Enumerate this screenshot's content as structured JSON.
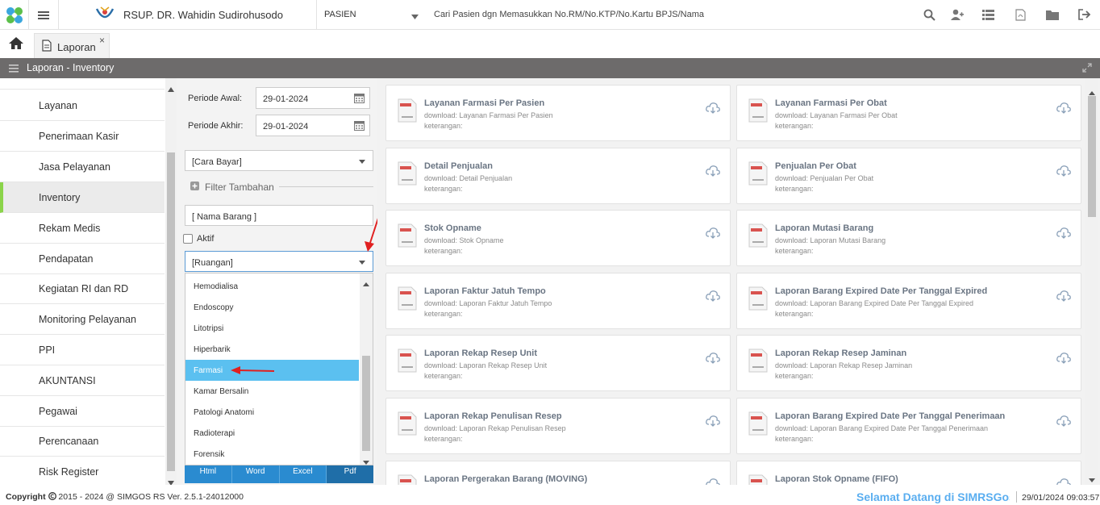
{
  "header": {
    "hospital_name": "RSUP. DR. Wahidin Sudirohusodo",
    "patient_select": "PASIEN",
    "search_placeholder": "Cari Pasien dgn Memasukkan No.RM/No.KTP/No.Kartu BPJS/Nama",
    "icons": [
      "search-icon",
      "add-user-icon",
      "list-icon",
      "pdf-icon",
      "folder-icon",
      "logout-icon"
    ]
  },
  "tabs": {
    "home": "home-icon",
    "active_tab": "Laporan",
    "close": "×"
  },
  "section": {
    "title": "Laporan - Inventory"
  },
  "sidebar": {
    "items": [
      {
        "label": "Layanan"
      },
      {
        "label": "Penerimaan Kasir"
      },
      {
        "label": "Jasa Pelayanan"
      },
      {
        "label": "Inventory",
        "active": true
      },
      {
        "label": "Rekam Medis"
      },
      {
        "label": "Pendapatan"
      },
      {
        "label": "Kegiatan RI dan RD"
      },
      {
        "label": "Monitoring Pelayanan"
      },
      {
        "label": "PPI"
      },
      {
        "label": "AKUNTANSI"
      },
      {
        "label": "Pegawai"
      },
      {
        "label": "Perencanaan"
      },
      {
        "label": "Risk Register"
      }
    ]
  },
  "filter": {
    "periode_awal_label": "Periode Awal:",
    "periode_awal_value": "29-01-2024",
    "periode_akhir_label": "Periode Akhir:",
    "periode_akhir_value": "29-01-2024",
    "cara_bayar": "[Cara Bayar]",
    "filter_tambahan": "Filter Tambahan",
    "nama_barang": "[ Nama Barang ]",
    "aktif_label": "Aktif",
    "ruangan": "[Ruangan]",
    "ruangan_options": [
      "Hemodialisa",
      "Endoscopy",
      "Litotripsi",
      "Hiperbarik",
      "Farmasi",
      "Kamar Bersalin",
      "Patologi Anatomi",
      "Radioterapi",
      "Forensik"
    ],
    "ruangan_selected": "Farmasi",
    "output_buttons": [
      "Html",
      "Word",
      "Excel",
      "Pdf"
    ]
  },
  "reports": [
    {
      "title": "Layanan Farmasi Per Pasien",
      "download": "download: Layanan Farmasi Per Pasien",
      "keterangan": "keterangan:"
    },
    {
      "title": "Layanan Farmasi Per Obat",
      "download": "download: Layanan Farmasi Per Obat",
      "keterangan": "keterangan:"
    },
    {
      "title": "Detail Penjualan",
      "download": "download: Detail Penjualan",
      "keterangan": "keterangan:"
    },
    {
      "title": "Penjualan Per Obat",
      "download": "download: Penjualan Per Obat",
      "keterangan": "keterangan:"
    },
    {
      "title": "Stok Opname",
      "download": "download: Stok Opname",
      "keterangan": "keterangan:"
    },
    {
      "title": "Laporan Mutasi Barang",
      "download": "download: Laporan Mutasi Barang",
      "keterangan": "keterangan:"
    },
    {
      "title": "Laporan Faktur Jatuh Tempo",
      "download": "download: Laporan Faktur Jatuh Tempo",
      "keterangan": "keterangan:"
    },
    {
      "title": "Laporan Barang Expired Date Per Tanggal Expired",
      "download": "download: Laporan Barang Expired Date Per Tanggal Expired",
      "keterangan": "keterangan:"
    },
    {
      "title": "Laporan Rekap Resep Unit",
      "download": "download: Laporan Rekap Resep Unit",
      "keterangan": "keterangan:"
    },
    {
      "title": "Laporan Rekap Resep Jaminan",
      "download": "download: Laporan Rekap Resep Jaminan",
      "keterangan": "keterangan:"
    },
    {
      "title": "Laporan Rekap Penulisan Resep",
      "download": "download: Laporan Rekap Penulisan Resep",
      "keterangan": "keterangan:"
    },
    {
      "title": "Laporan Barang Expired Date Per Tanggal Penerimaan",
      "download": "download: Laporan Barang Expired Date Per Tanggal Penerimaan",
      "keterangan": "keterangan:"
    },
    {
      "title": "Laporan Pergerakan Barang (MOVING)",
      "download": "",
      "keterangan": ""
    },
    {
      "title": "Laporan Stok Opname (FIFO)",
      "download": "",
      "keterangan": ""
    }
  ],
  "footer": {
    "copyright": "Copyright",
    "copyright_text": "2015 - 2024 @ SIMGOS RS Ver. 2.5.1-24012000",
    "welcome": "Selamat Datang di SIMRSGos",
    "datetime": "29/01/2024 09:03:57"
  },
  "colors": {
    "accent": "#5bc0f0",
    "header_bar": "#6d6b6b",
    "active_marker": "#8bd44a",
    "button_blue": "#2a8bd0",
    "annotation_arrow": "#e02020"
  }
}
